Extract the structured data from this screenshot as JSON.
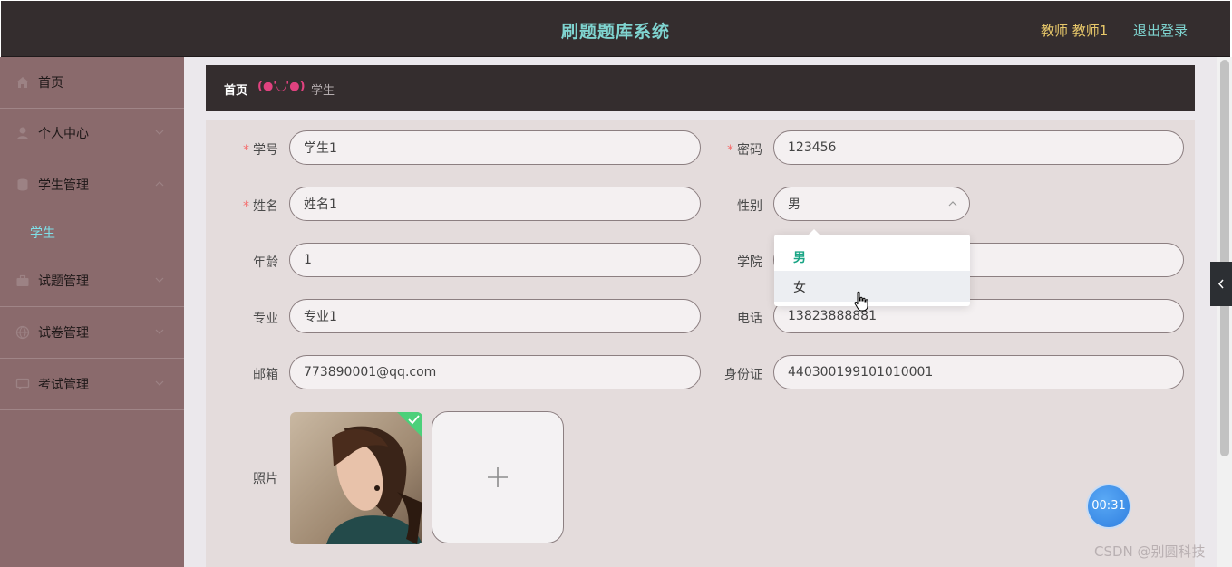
{
  "header": {
    "title": "刷题题库系统",
    "user": "教师 教师1",
    "logout": "退出登录"
  },
  "sidebar": {
    "items": [
      {
        "label": "首页",
        "icon": "home-icon"
      },
      {
        "label": "个人中心",
        "icon": "user-icon"
      },
      {
        "label": "学生管理",
        "icon": "database-icon"
      },
      {
        "label": "试题管理",
        "icon": "briefcase-icon"
      },
      {
        "label": "试卷管理",
        "icon": "globe-icon"
      },
      {
        "label": "考试管理",
        "icon": "chat-icon"
      }
    ],
    "sub_item": "学生"
  },
  "breadcrumb": {
    "home": "首页",
    "separator": "(●'◡'●)",
    "current": "学生"
  },
  "form": {
    "student_id": {
      "label": "学号",
      "value": "学生1"
    },
    "password": {
      "label": "密码",
      "value": "123456"
    },
    "name": {
      "label": "姓名",
      "value": "姓名1"
    },
    "gender": {
      "label": "性别",
      "value": "男"
    },
    "age": {
      "label": "年龄",
      "value": "1"
    },
    "college": {
      "label": "学院",
      "value": ""
    },
    "major": {
      "label": "专业",
      "value": "专业1"
    },
    "phone": {
      "label": "电话",
      "value": "13823888881"
    },
    "email": {
      "label": "邮箱",
      "value": "773890001@qq.com"
    },
    "id_card": {
      "label": "身份证",
      "value": "440300199101010001"
    },
    "photo": {
      "label": "照片"
    }
  },
  "dropdown": {
    "options": [
      "男",
      "女"
    ]
  },
  "timer": "00:31",
  "watermark": "CSDN @别圆科技",
  "colors": {
    "header_bg": "#342d2e",
    "sidebar_bg": "#8a6a6c",
    "title": "#7fd4d0",
    "user": "#e8c86a",
    "selected_option": "#1aa585",
    "required": "#f56c6c"
  }
}
